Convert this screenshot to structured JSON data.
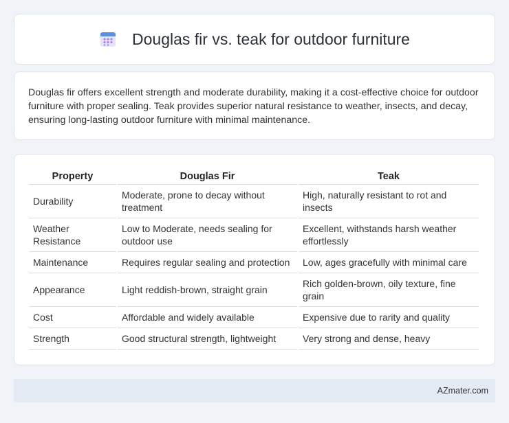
{
  "header": {
    "title": "Douglas fir vs. teak for outdoor furniture",
    "icon": "calendar-icon"
  },
  "summary": {
    "text": "Douglas fir offers excellent strength and moderate durability, making it a cost-effective choice for outdoor furniture with proper sealing. Teak provides superior natural resistance to weather, insects, and decay, ensuring long-lasting outdoor furniture with minimal maintenance."
  },
  "table": {
    "headers": [
      "Property",
      "Douglas Fir",
      "Teak"
    ],
    "rows": [
      [
        "Durability",
        "Moderate, prone to decay without treatment",
        "High, naturally resistant to rot and insects"
      ],
      [
        "Weather Resistance",
        "Low to Moderate, needs sealing for outdoor use",
        "Excellent, withstands harsh weather effortlessly"
      ],
      [
        "Maintenance",
        "Requires regular sealing and protection",
        "Low, ages gracefully with minimal care"
      ],
      [
        "Appearance",
        "Light reddish-brown, straight grain",
        "Rich golden-brown, oily texture, fine grain"
      ],
      [
        "Cost",
        "Affordable and widely available",
        "Expensive due to rarity and quality"
      ],
      [
        "Strength",
        "Good structural strength, lightweight",
        "Very strong and dense, heavy"
      ]
    ]
  },
  "footer": {
    "brand": "AZmater.com"
  }
}
